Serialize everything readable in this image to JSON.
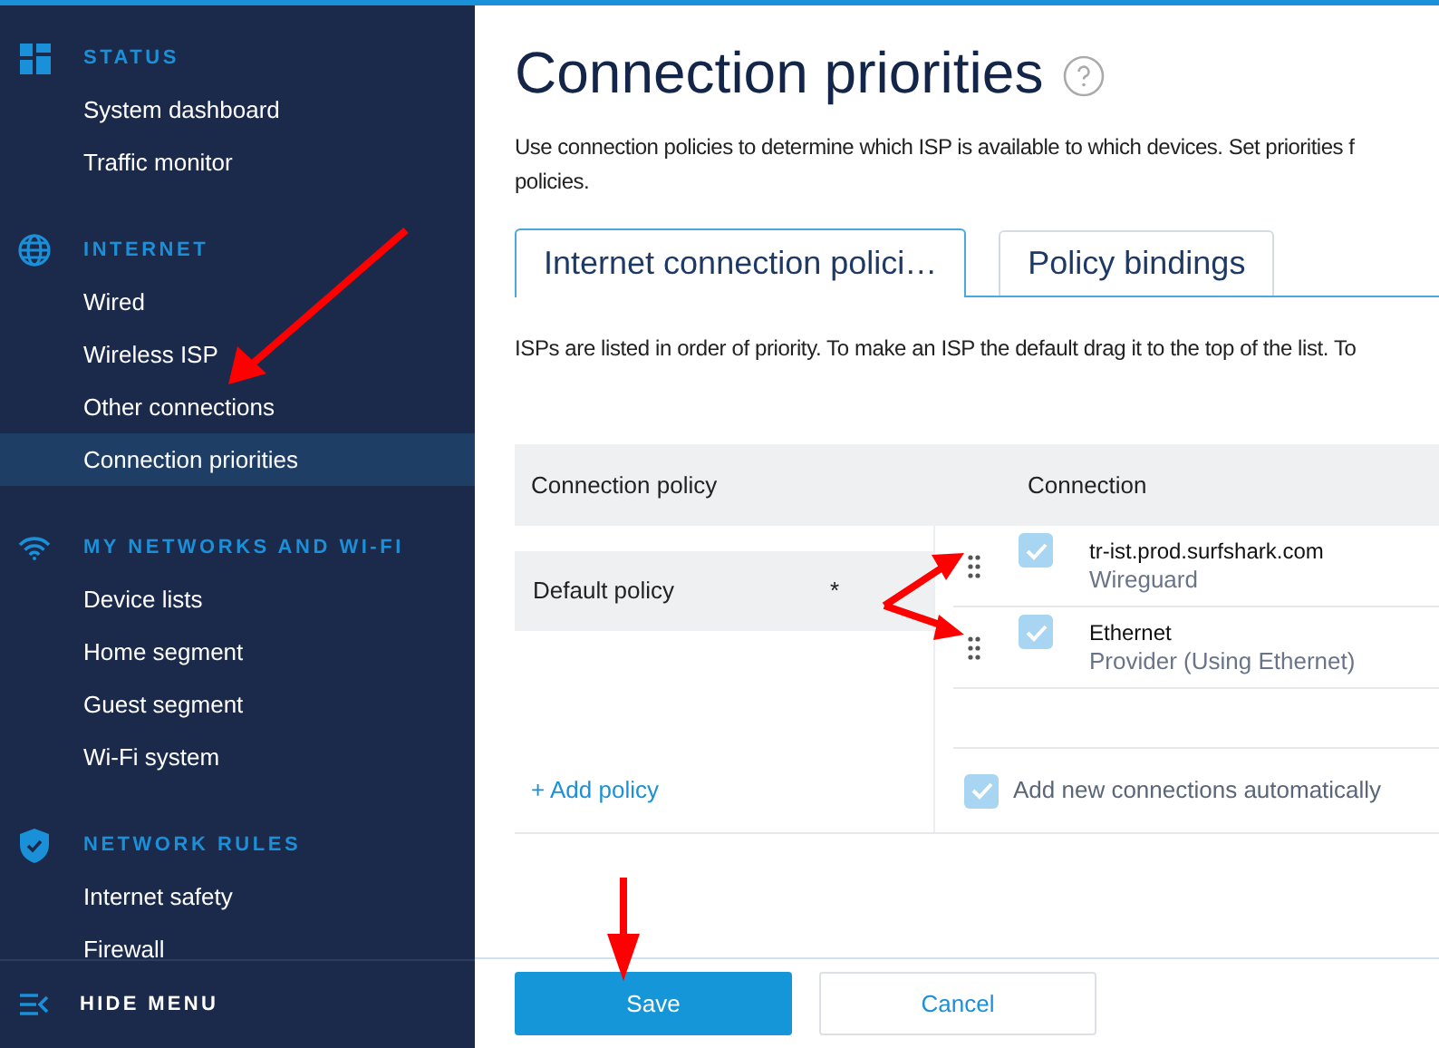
{
  "sidebar": {
    "sections": [
      {
        "title": "STATUS",
        "items": [
          {
            "label": "System dashboard",
            "selected": false
          },
          {
            "label": "Traffic monitor",
            "selected": false
          }
        ]
      },
      {
        "title": "INTERNET",
        "items": [
          {
            "label": "Wired",
            "selected": false
          },
          {
            "label": "Wireless ISP",
            "selected": false
          },
          {
            "label": "Other connections",
            "selected": false
          },
          {
            "label": "Connection priorities",
            "selected": true
          }
        ]
      },
      {
        "title": "MY NETWORKS AND WI-FI",
        "items": [
          {
            "label": "Device lists",
            "selected": false
          },
          {
            "label": "Home segment",
            "selected": false
          },
          {
            "label": "Guest segment",
            "selected": false
          },
          {
            "label": "Wi-Fi system",
            "selected": false
          }
        ]
      },
      {
        "title": "NETWORK RULES",
        "items": [
          {
            "label": "Internet safety",
            "selected": false
          },
          {
            "label": "Firewall",
            "selected": false
          }
        ]
      }
    ],
    "hide_menu": "HIDE MENU"
  },
  "page": {
    "title": "Connection priorities",
    "description_lines": [
      "Use connection policies to determine which ISP is available to which devices. Set priorities f",
      "policies."
    ],
    "tabs": [
      {
        "label": "Internet connection polici…",
        "selected": true
      },
      {
        "label": "Policy bindings",
        "selected": false
      }
    ],
    "hint": "ISPs are listed in order of priority. To make an ISP the default drag it to the top of the list. To",
    "table": {
      "columns": [
        "Connection policy",
        "Connection"
      ],
      "policies": [
        {
          "name": "Default policy",
          "marker": "*",
          "selected": true
        }
      ],
      "add_policy": "+ Add policy",
      "connections": [
        {
          "name": "tr-ist.prod.surfshark.com",
          "type": "Wireguard",
          "checked": true
        },
        {
          "name": "Ethernet",
          "type": "Provider (Using Ethernet)",
          "checked": true
        }
      ],
      "auto_add": {
        "label": "Add new connections automatically",
        "checked": true
      }
    },
    "buttons": [
      {
        "kind": "primary",
        "label": "Save"
      },
      {
        "kind": "secondary",
        "label": "Cancel"
      }
    ]
  }
}
